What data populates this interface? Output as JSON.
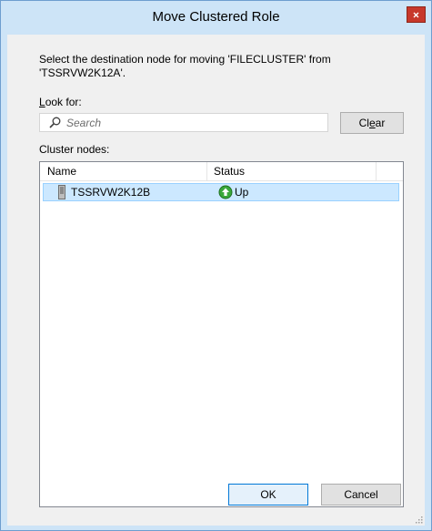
{
  "window": {
    "title": "Move Clustered Role",
    "close_label": "x"
  },
  "dialog": {
    "instruction": "Select the destination node for moving 'FILECLUSTER' from 'TSSRVW2K12A'.",
    "look_for_label": "Look for:",
    "search_placeholder": "Search",
    "clear_label": "Clear",
    "cluster_nodes_label": "Cluster nodes:"
  },
  "table": {
    "columns": [
      "Name",
      "Status"
    ],
    "rows": [
      {
        "name": "TSSRVW2K12B",
        "status": "Up",
        "status_icon": "green-up-arrow-icon",
        "selected": true
      }
    ]
  },
  "buttons": {
    "ok": "OK",
    "cancel": "Cancel"
  },
  "colors": {
    "frame": "#cde4f7",
    "close_button": "#c7382b",
    "selection": "#cce8ff",
    "status_up": "#3aa83a"
  }
}
